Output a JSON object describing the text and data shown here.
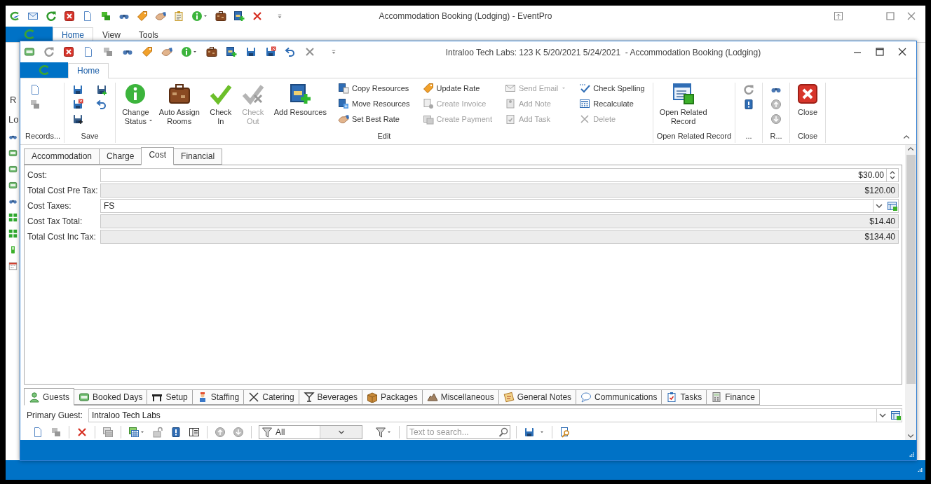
{
  "main_window": {
    "title": "Accommodation Booking (Lodging) - EventPro",
    "ribbon_tabs": [
      {
        "label": "Home",
        "selected": true
      },
      {
        "label": "View",
        "selected": false
      },
      {
        "label": "Tools",
        "selected": false
      }
    ],
    "side_panel": {
      "label": "R",
      "title": "Lo"
    }
  },
  "dialog": {
    "title": "Intraloo Tech Labs: 123 K 5/20/2021 5/24/2021  - Accommodation Booking (Lodging)",
    "ribbon_tabs": [
      {
        "label": "Home",
        "selected": true
      }
    ],
    "ribbon_groups": [
      {
        "label": "Records...",
        "kind": "records"
      },
      {
        "label": "Save",
        "kind": "save"
      },
      {
        "label": "Edit",
        "kind": "edit",
        "large": [
          {
            "label": "Change\nStatus",
            "disabled": false,
            "dropdown": true
          },
          {
            "label": "Auto Assign\nRooms",
            "disabled": false,
            "dropdown": false
          },
          {
            "label": "Check\nIn",
            "disabled": false,
            "dropdown": false
          },
          {
            "label": "Check\nOut",
            "disabled": true,
            "dropdown": false
          },
          {
            "label": "Add Resources",
            "disabled": false,
            "dropdown": false
          }
        ],
        "small": [
          [
            {
              "label": "Copy Resources",
              "disabled": false,
              "dropdown": false
            },
            {
              "label": "Move Resources",
              "disabled": false,
              "dropdown": false
            },
            {
              "label": "Set Best Rate",
              "disabled": false,
              "dropdown": false
            }
          ],
          [
            {
              "label": "Update Rate",
              "disabled": false,
              "dropdown": false
            },
            {
              "label": "Create Invoice",
              "disabled": true,
              "dropdown": false
            },
            {
              "label": "Create Payment",
              "disabled": true,
              "dropdown": false
            }
          ],
          [
            {
              "label": "Send Email",
              "disabled": true,
              "dropdown": true
            },
            {
              "label": "Add Note",
              "disabled": true,
              "dropdown": false
            },
            {
              "label": "Add Task",
              "disabled": true,
              "dropdown": false
            }
          ],
          [
            {
              "label": "Check Spelling",
              "disabled": false,
              "dropdown": false
            },
            {
              "label": "Recalculate",
              "disabled": false,
              "dropdown": false
            },
            {
              "label": "Delete",
              "disabled": true,
              "dropdown": false
            }
          ]
        ]
      },
      {
        "label": "Open Related Record",
        "kind": "related",
        "large": [
          {
            "label": "Open Related\nRecord",
            "disabled": false,
            "dropdown": false
          }
        ]
      },
      {
        "label": "...",
        "kind": "refresh"
      },
      {
        "label": "R...",
        "kind": "navigate"
      },
      {
        "label": "Close",
        "kind": "close",
        "large": [
          {
            "label": "Close",
            "disabled": false,
            "dropdown": false
          }
        ]
      }
    ],
    "record_tabs": [
      {
        "label": "Accommodation",
        "selected": false
      },
      {
        "label": "Charge",
        "selected": false
      },
      {
        "label": "Cost",
        "selected": true
      },
      {
        "label": "Financial",
        "selected": false
      }
    ],
    "fields": [
      {
        "label": "Cost:",
        "value": "$30.00",
        "kind": "spin"
      },
      {
        "label": "Total Cost Pre Tax:",
        "value": "$120.00",
        "kind": "readonly"
      },
      {
        "label": "Cost Taxes:",
        "value": "FS",
        "kind": "lookup"
      },
      {
        "label": "Cost Tax Total:",
        "value": "$14.40",
        "kind": "readonly"
      },
      {
        "label": "Total Cost Inc Tax:",
        "value": "$134.40",
        "kind": "readonly"
      }
    ],
    "detail_tabs": [
      {
        "label": "Guests",
        "selected": true
      },
      {
        "label": "Booked Days",
        "selected": false
      },
      {
        "label": "Setup",
        "selected": false
      },
      {
        "label": "Staffing",
        "selected": false
      },
      {
        "label": "Catering",
        "selected": false
      },
      {
        "label": "Beverages",
        "selected": false
      },
      {
        "label": "Packages",
        "selected": false
      },
      {
        "label": "Miscellaneous",
        "selected": false
      },
      {
        "label": "General Notes",
        "selected": false
      },
      {
        "label": "Communications",
        "selected": false
      },
      {
        "label": "Tasks",
        "selected": false
      },
      {
        "label": "Finance",
        "selected": false
      }
    ],
    "primary_guest": {
      "label": "Primary Guest:",
      "value": "Intraloo Tech Labs"
    },
    "toolbar": {
      "filter": "All",
      "search": {
        "placeholder": "Text to search..."
      }
    }
  }
}
